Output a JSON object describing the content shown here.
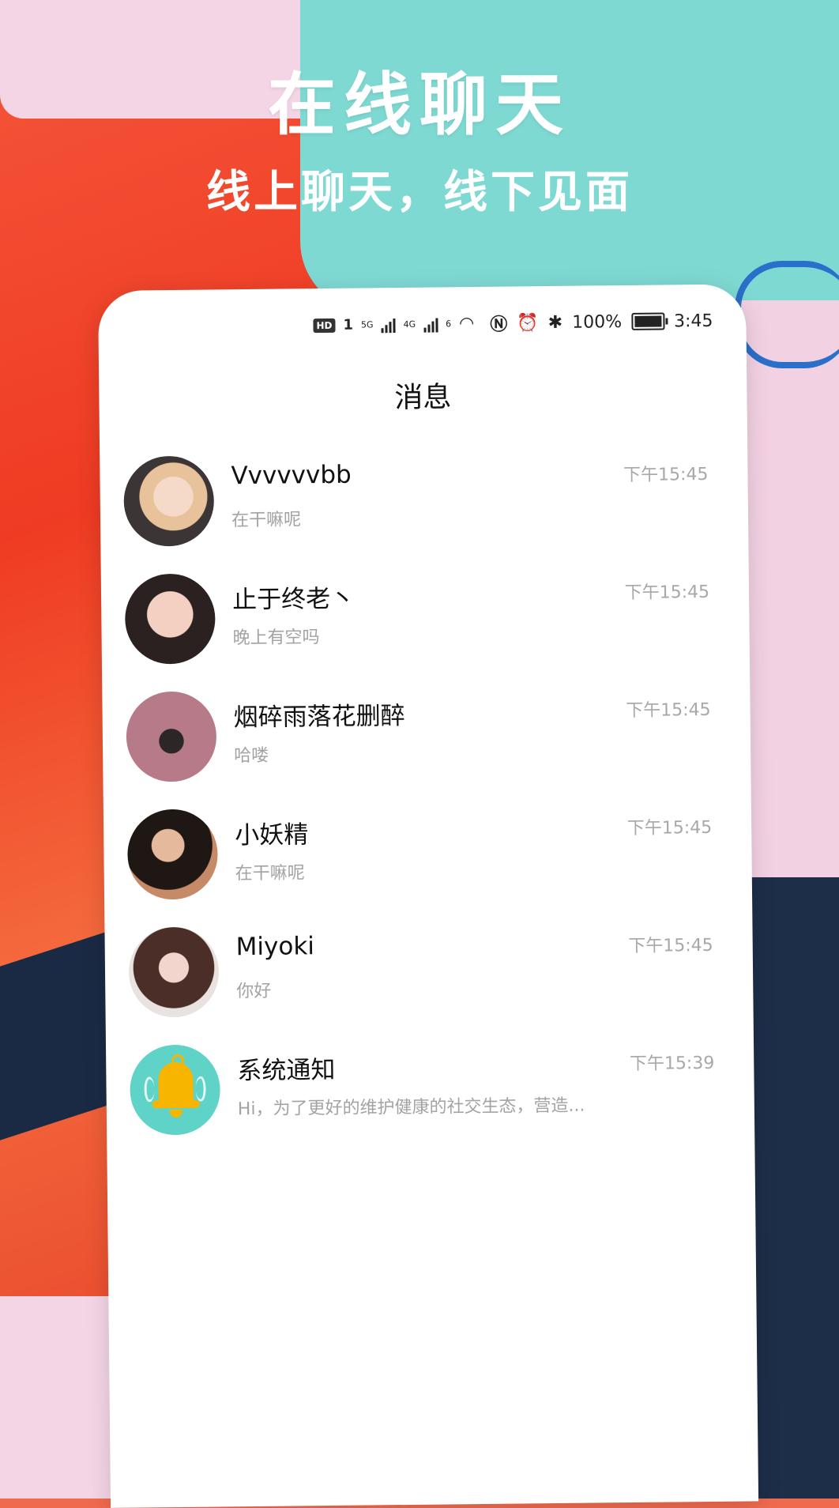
{
  "hero": {
    "title": "在线聊天",
    "subtitle": "线上聊天，线下见面"
  },
  "statusbar": {
    "hd": "HD",
    "sim1": "1",
    "net1": "5G",
    "net2": "4G",
    "wifi": "6",
    "battery": "100%",
    "time": "3:45"
  },
  "page": {
    "title": "消息"
  },
  "conversations": [
    {
      "name": "Vvvvvvbb",
      "preview": "在干嘛呢",
      "time": "下午15:45",
      "avatar": "user-photo"
    },
    {
      "name": "止于终老丶",
      "preview": "晚上有空吗",
      "time": "下午15:45",
      "avatar": "user-photo"
    },
    {
      "name": "烟碎雨落花删醉",
      "preview": "哈喽",
      "time": "下午15:45",
      "avatar": "user-photo"
    },
    {
      "name": "小妖精",
      "preview": "在干嘛呢",
      "time": "下午15:45",
      "avatar": "user-photo"
    },
    {
      "name": "Miyoki",
      "preview": "你好",
      "time": "下午15:45",
      "avatar": "user-photo"
    },
    {
      "name": "系统通知",
      "preview": "Hi，为了更好的维护健康的社交生态，营造...",
      "time": "下午15:39",
      "avatar": "bell-icon"
    }
  ],
  "colors": {
    "teal": "#7fd9d3",
    "bell": "#f7b500",
    "accent_red": "#ef3b23"
  }
}
